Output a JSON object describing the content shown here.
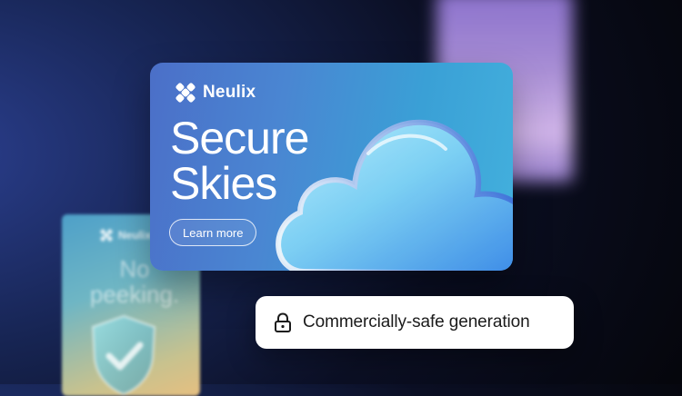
{
  "main_card": {
    "brand": "Neulix",
    "headline_line1": "Secure",
    "headline_line2": "Skies",
    "cta_label": "Learn more"
  },
  "secondary_card": {
    "brand": "Neulix",
    "headline_line1": "No",
    "headline_line2": "peeking."
  },
  "badge": {
    "label": "Commercially-safe generation",
    "icon": "lock-icon"
  },
  "colors": {
    "card_gradient_start": "#4b6fc8",
    "card_gradient_end": "#43b0dd",
    "badge_bg": "#ffffff",
    "badge_text": "#1b1b1b"
  }
}
